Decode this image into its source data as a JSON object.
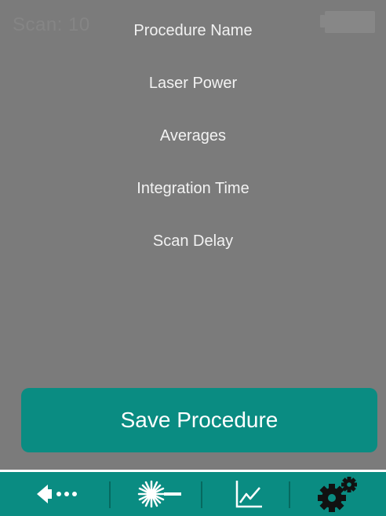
{
  "status": {
    "scan_text": "Scan: 10"
  },
  "menu": {
    "items": [
      {
        "label": "Procedure Name"
      },
      {
        "label": "Laser Power"
      },
      {
        "label": "Averages"
      },
      {
        "label": "Integration Time"
      },
      {
        "label": "Scan Delay"
      }
    ]
  },
  "actions": {
    "save_label": "Save Procedure"
  },
  "nav": {
    "items": [
      {
        "icon": "back-arrow-icon"
      },
      {
        "icon": "laser-icon"
      },
      {
        "icon": "chart-icon"
      },
      {
        "icon": "settings-gears-icon"
      }
    ]
  },
  "colors": {
    "background": "#7b7b7b",
    "accent": "#0a8c82",
    "text": "#f2f2f2"
  }
}
